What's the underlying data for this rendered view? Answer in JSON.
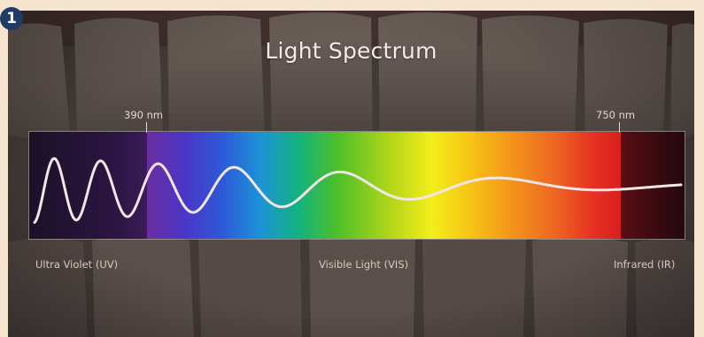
{
  "badge": {
    "number": "1"
  },
  "title": "Light Spectrum",
  "markers": {
    "left_nm": "390 nm",
    "right_nm": "750 nm"
  },
  "regions": {
    "uv": "Ultra Violet (UV)",
    "visible": "Visible Light (VIS)",
    "ir": "Infrared (IR)"
  },
  "colors": {
    "page_background": "#f6e4cf",
    "badge": "#1f3b66",
    "uv_band": "#2a1540",
    "ir_band": "#3a0a10",
    "wave": "#f3e6e6"
  }
}
